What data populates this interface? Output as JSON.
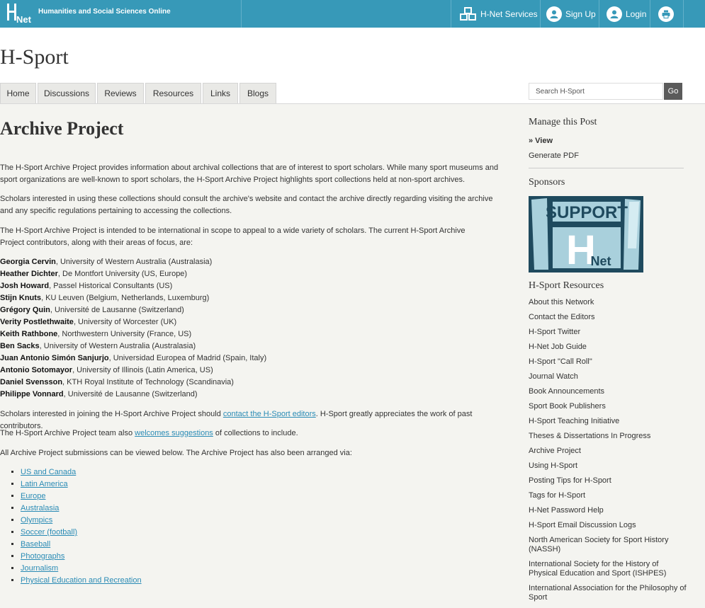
{
  "topbar": {
    "site_title": "Humanities and Social Sciences Online",
    "services_label": "H-Net Services",
    "signup_label": "Sign Up",
    "login_label": "Login"
  },
  "network_title": "H-Sport",
  "nav": {
    "tabs": [
      "Home",
      "Discussions",
      "Reviews",
      "Resources",
      "Links",
      "Blogs"
    ]
  },
  "search": {
    "placeholder": "Search H-Sport",
    "go_label": "Go"
  },
  "main": {
    "heading": "Archive Project",
    "intro_1": "The H-Sport Archive Project provides information about archival collections that are of interest to sport scholars.  While many sport museums and sport organizations are well-known to sport scholars, the H-Sport Archive Project highlights sport collections held at non-sport archives.",
    "intro_2": "Scholars interested in using these collections should consult the archive's website and contact the archive directly regarding visiting the archive and any specific regulations pertaining to accessing the collections.",
    "intro_3": "The H-Sport Archive Project is intended to be international in scope to appeal to a wide variety of scholars.  The current H-Sport Archive Project contributors, along with their areas of focus, are:",
    "contributors": [
      {
        "name": "Georgia Cervin",
        "detail": ", University of Western Australia (Australasia)"
      },
      {
        "name": "Heather Dichter",
        "detail": ", De Montfort University (US, Europe)"
      },
      {
        "name": "Josh Howard",
        "detail": ", Passel Historical Consultants (US)"
      },
      {
        "name": "Stijn Knuts",
        "detail": ", KU Leuven (Belgium, Netherlands, Luxemburg)"
      },
      {
        "name": "Grégory Quin",
        "detail": ", Université de Lausanne (Switzerland)"
      },
      {
        "name": "Verity Postlethwaite",
        "detail": ", University of Worcester (UK)"
      },
      {
        "name": "Keith Rathbone",
        "detail": ", Northwestern University (France, US)"
      },
      {
        "name": "Ben Sacks",
        "detail": ", University of Western Australia (Australasia)"
      },
      {
        "name": "Juan Antonio Simón Sanjurjo",
        "detail": ", Universidad Europea of Madrid (Spain, Italy)"
      },
      {
        "name": "Antonio Sotomayor",
        "detail": ", University of Illinois (Latin America, US)"
      },
      {
        "name": "Daniel Svensson",
        "detail": ", KTH Royal Institute of Technology (Scandinavia)"
      },
      {
        "name": "Philippe Vonnard",
        "detail": ", Université de Lausanne (Switzerland)"
      }
    ],
    "join_before": "Scholars interested in joining the H-Sport Archive Project should ",
    "join_link": "contact the H-Sport editors",
    "join_after": ". H-Sport greatly appreciates the work of past contributors.",
    "team_before": "The H-Sport Archive Project team also ",
    "team_link": "welcomes suggestions",
    "team_after": " of collections to include.",
    "arranged_text": "All Archive Project submissions can be viewed below. The Archive Project has also been arranged via:",
    "categories": [
      "US and Canada",
      "Latin America",
      "Europe",
      "Australasia",
      "Olympics",
      "Soccer (football)",
      "Baseball",
      "Photographs",
      "Journalism",
      "Physical Education and Recreation"
    ]
  },
  "sidebar": {
    "manage_heading": "Manage this Post",
    "view_label": "» View",
    "pdf_label": "Generate PDF",
    "sponsors_heading": "Sponsors",
    "sponsor_text_1": "SUPPORT",
    "sponsor_text_2": "H",
    "sponsor_text_3": "Net",
    "resources_heading": "H-Sport Resources",
    "resources": [
      "About this Network",
      "Contact the Editors",
      "H-Sport Twitter",
      "H-Net Job Guide",
      "H-Sport \"Call Roll\"",
      "Journal Watch",
      "Book Announcements",
      "Sport Book Publishers",
      "H-Sport Teaching Initiative",
      "Theses & Dissertations In Progress",
      "Archive Project",
      "Using H-Sport",
      "Posting Tips for H-Sport",
      "Tags for H-Sport",
      "H-Net Password Help",
      "H-Sport Email Discussion Logs",
      "North American Society for Sport History (NASSH)",
      "International Society for the History of Physical Education and Sport (ISHPES)",
      "International Association for the Philosophy of Sport"
    ]
  },
  "colors": {
    "topbar": "#3799b8",
    "link": "#2a8bb5",
    "sponsor_bg": "#1f4a5e"
  }
}
